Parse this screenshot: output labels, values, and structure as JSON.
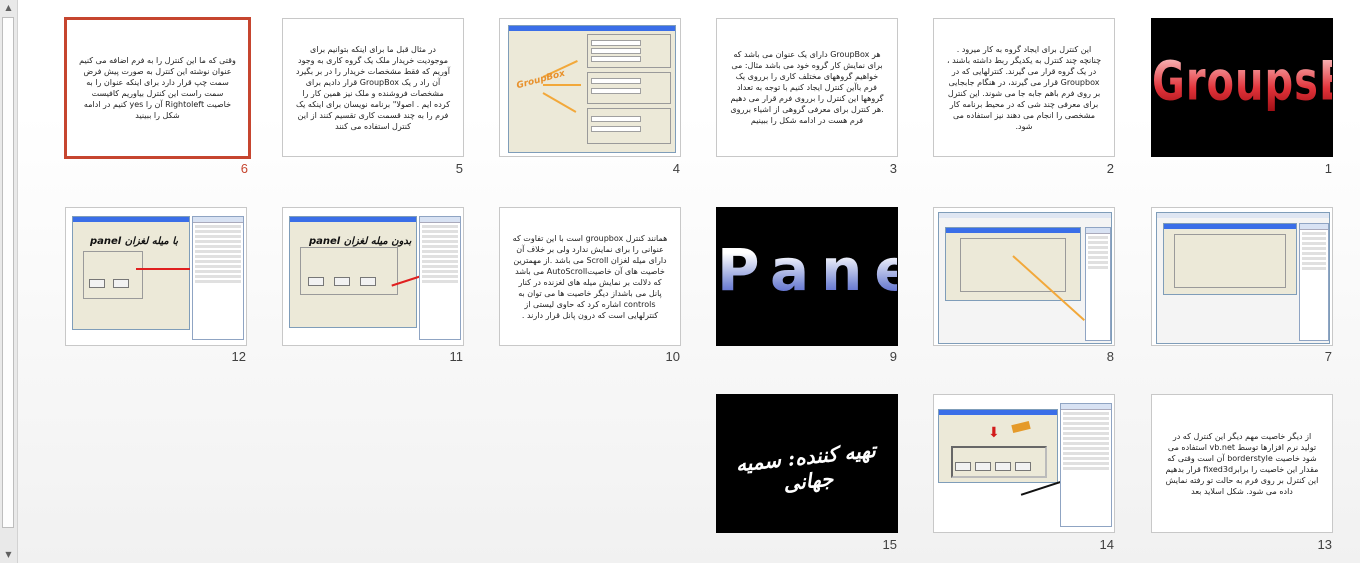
{
  "scrollbar": {
    "up": "▲",
    "down": "▼"
  },
  "slides": [
    {
      "number": "1",
      "title_art": "GroupsBox"
    },
    {
      "number": "2",
      "text": "این کنترل برای ایجاد گروه به کار میرود . چنانچه چند کنترل به یکدیگر ربط داشته باشند ، در یک گروه قرار می گیرند. کنترلهایی که در Groupbox قرار می گیرند، در هنگام جابجایی بر روی فرم باهم جابه جا می شوند. این کنترل برای معرفی چند شی که در محیط برنامه کار مشخصی را انجام می دهند نیز استفاده می شود."
    },
    {
      "number": "3",
      "text": "هر GroupBox دارای یک عنوان می باشد که برای نمایش کار گروه خود می باشد مثال: می خواهیم گروههای مختلف کاری را برروی یک فرم باآین کنترل ایجاد کنیم با توجه به تعداد گروهها این کنترل را برروی فرم قرار می دهیم .هر کنترل برای معرفی گروهی از اشیاء برروی فرم هست در ادامه شکل را ببینیم"
    },
    {
      "number": "4",
      "label_art": "GroupBox"
    },
    {
      "number": "5",
      "text": "در مثال قبل ما برای اینکه بتوانیم برای موجودیت خریدار ملک یک گروه کاری به وجود آوریم که فقط مشخصات خریدار را در بر بگیرد آن راد ر یک GroupBox قرار دادیم برای مشخصات فروشنده و ملک نیز همین کار را کرده ایم . اصولا\" برنامه نویسان برای اینکه یک فرم را به چند قسمت کاری تقسیم کنند از این کنترل استفاده می کنند"
    },
    {
      "number": "6",
      "text": "وقتی که ما این کنترل را به فرم اضافه می کنیم عنوان نوشته این کنترل به صورت پیش فرض سمت چپ قرار دارد برای اینکه عنوان را به سمت راست این کنترل بیاوریم کافیست خاصیت Rightoleft آن را yes کنیم در ادامه شکل را ببینید"
    },
    {
      "number": "7"
    },
    {
      "number": "8"
    },
    {
      "number": "9",
      "title_art": "Panel"
    },
    {
      "number": "10",
      "text": "همانند کنترل groupbox است با این تفاوت که عنوانی را برای نمایش ندارد ولی بر خلاف آن دارای میله لغزان Scroll می باشد .از مهمترین خاصیت های آن خاصیتAutoScroll می باشد که دلالت بر نمایش میله های لغزنده در کنار پانل می باشداز دیگر خاصیت ها می توان به controls اشاره کرد که حاوی لیستی از کنترلهایی است که درون پانل قرار دارند ."
    },
    {
      "number": "11",
      "label_art": "بدون میله لغزان panel"
    },
    {
      "number": "12",
      "label_art": "با میله لغزان panel"
    },
    {
      "number": "13",
      "text": "از دیگر خاصیت مهم دیگر این کنترل که در تولید نرم افزارها توسط vb.net استفاده می شود خاصیت borderstyle آن است وقتی که مقدار این خاصیت را برابرfixed3d قرار بدهیم این کنترل بر روی فرم به حالت تو رفته نمایش داده می شود. شکل اسلاید بعد"
    },
    {
      "number": "14"
    },
    {
      "number": "15",
      "title_art": "تهیه کننده: سمیه جهانی"
    }
  ]
}
